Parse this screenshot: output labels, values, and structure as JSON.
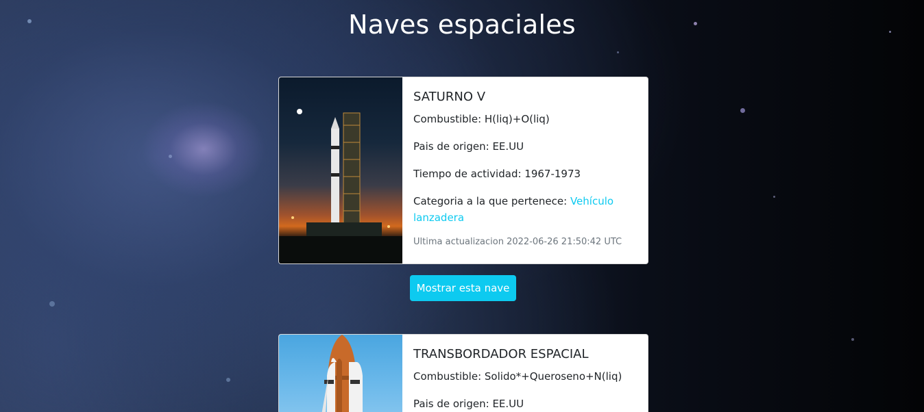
{
  "page": {
    "title": "Naves espaciales"
  },
  "ships": [
    {
      "name": "SATURNO V",
      "fuel_label": "Combustible: ",
      "fuel": "H(liq)+O(liq)",
      "origin_label": "Pais de origen: ",
      "origin": "EE.UU",
      "activity_label": "Tiempo de actividad: ",
      "activity": "1967-1973",
      "category_label": "Categoria a la que pertenece: ",
      "category": "Vehículo lanzadera",
      "updated": "Ultima actualizacion 2022-06-26 21:50:42 UTC",
      "show_button": "Mostrar esta nave"
    },
    {
      "name": "TRANSBORDADOR ESPACIAL",
      "fuel_label": "Combustible: ",
      "fuel": "Solido*+Queroseno+N(liq)",
      "origin_label": "Pais de origen: ",
      "origin": "EE.UU"
    }
  ],
  "colors": {
    "accent": "#0dcaf0",
    "card_background": "#ffffff",
    "title_text": "#ffffff"
  }
}
